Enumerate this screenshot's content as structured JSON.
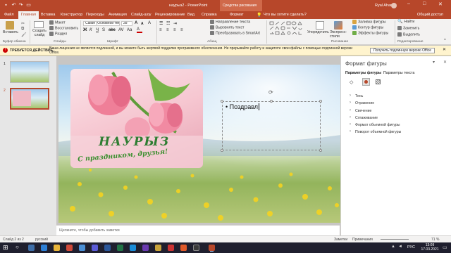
{
  "titlebar": {
    "title": "наурыз2 - PowerPoint",
    "context_tab_title": "Средства рисования",
    "user": "Ryal Ahan",
    "qat_icons": [
      "save-icon",
      "undo-icon",
      "redo-icon",
      "present-icon"
    ]
  },
  "tabs": [
    "Файл",
    "Главная",
    "Вставка",
    "Конструктор",
    "Переходы",
    "Анимация",
    "Слайд-шоу",
    "Рецензирование",
    "Вид",
    "Справка",
    "Формат"
  ],
  "tell_me": "Что вы хотите сделать?",
  "share_label": "Общий доступ",
  "ribbon": {
    "clipboard": {
      "paste": "Вставить",
      "group": "Буфер обмена"
    },
    "slides": {
      "new": "Создать слайд",
      "layout": "Макет",
      "reset": "Восстановить",
      "section": "Раздел",
      "group": "Слайды"
    },
    "font": {
      "name": "Calibri (Основной тек",
      "size": "28",
      "group": "Шрифт"
    },
    "paragraph": {
      "direction": "Направление текста",
      "align": "Выровнять текст",
      "smartart": "Преобразовать в SmartArt",
      "group": "Абзац"
    },
    "drawing": {
      "arrange": "Упорядочить",
      "quick_styles": "Экспресс-стили",
      "fill": "Заливка фигуры",
      "outline": "Контур фигуры",
      "effects": "Эффекты фигуры",
      "group": "Рисование"
    },
    "editing": {
      "find": "Найти",
      "replace": "Заменить",
      "select": "Выделить",
      "group": "Редактирование"
    }
  },
  "infobar": {
    "label": "ТРЕБУЕТСЯ ДЕЙСТВИЕ",
    "text": "Ваша лицензия не является подлинной, и вы можете быть жертвой подделки программного обеспечения. Не прерывайте работу и защитите свои файлы с помощью подлинной версии Office.",
    "button": "Получить подлинную версию Office"
  },
  "thumbnails": [
    {
      "num": "1"
    },
    {
      "num": "2"
    }
  ],
  "slide": {
    "bullet_text": "Поздравл",
    "title_art": "НАУРЫЗ",
    "subtitle_art": "С праздником, друзья!"
  },
  "notes_placeholder": "Щелкните, чтобы добавить заметки",
  "format_pane": {
    "title": "Формат фигуры",
    "tab_shape": "Параметры фигуры",
    "tab_text": "Параметры текста",
    "sections": [
      "Тень",
      "Отражение",
      "Свечение",
      "Сглаживание",
      "Формат объемной фигуры",
      "Поворот объемной фигуры"
    ]
  },
  "statusbar": {
    "slide_count": "Слайд 2 из 2",
    "language": "русский",
    "notes": "Заметки",
    "comments": "Примечания",
    "zoom": "71 %"
  },
  "taskbar": {
    "lang": "РУС",
    "time": "13:09",
    "date": "17.03.2021"
  },
  "colors": {
    "accent": "#b7472a",
    "ribbon": "#f3f2f1"
  }
}
